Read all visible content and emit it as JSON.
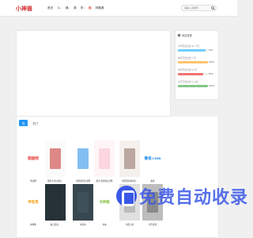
{
  "header": {
    "logo_text": "小神兽",
    "nav": [
      {
        "label": "首页",
        "has_dropdown": false
      },
      {
        "label": "人",
        "has_dropdown": true
      },
      {
        "label": "铺",
        "has_dropdown": true
      },
      {
        "label": "源",
        "has_dropdown": false
      },
      {
        "label": "学",
        "has_dropdown": true
      },
      {
        "label": "站",
        "has_dropdown": false,
        "hot": true
      },
      {
        "label": "林题源",
        "has_dropdown": false
      }
    ],
    "search_placeholder": "请输入关键字..."
  },
  "panel": {
    "title": "网站进程",
    "stats": [
      {
        "label": "今年已经过去 11 个月",
        "pct": 92,
        "pct_text": "92%",
        "color": "#4fc3f7"
      },
      {
        "label": "本月已经过去 7 天",
        "pct": 100,
        "pct_text": "100%",
        "color": "#ffb74d"
      },
      {
        "label": "本周已经过去 22 天",
        "pct": 85,
        "pct_text": "85%",
        "color": "#ef5350"
      },
      {
        "label": "今天已经过去 9 小时",
        "pct": 100,
        "pct_text": "100%",
        "color": "#66bb6a"
      }
    ]
  },
  "tabs": [
    {
      "label": "热",
      "active": true
    },
    {
      "label": "热门",
      "active": false
    }
  ],
  "cards_row1": [
    {
      "label": "国法网",
      "thumb_text": "图旋网",
      "thumb_color": "#e53935",
      "bg": "#ffffff"
    },
    {
      "label": "国家企业信用信...",
      "thumb_text": "",
      "thumb_color": "#c62828",
      "bg": "#fafafa"
    },
    {
      "label": "中国裁判文书网",
      "thumb_text": "",
      "thumb_color": "#1e88e5",
      "bg": "#ffffff"
    },
    {
      "label": "重庆市健康信息网",
      "thumb_text": "",
      "thumb_color": "#f8bbd0",
      "bg": "#fff5f7"
    },
    {
      "label": "中国国家图书馆...",
      "thumb_text": "",
      "thumb_color": "#8d6e63",
      "bg": "#f5f0ee"
    },
    {
      "label": "看看",
      "thumb_text": "看视.com",
      "thumb_color": "#1e88e5",
      "bg": "#ffffff"
    }
  ],
  "cards_row2": [
    {
      "label": "神笔笔",
      "thumb_text": "神笔馬",
      "thumb_color": "#f9a825",
      "bg": "#ffffff"
    },
    {
      "label": "看日语自...",
      "thumb_text": "",
      "thumb_color": "#263238",
      "bg": "#263238"
    },
    {
      "label": "尚阅书",
      "thumb_text": "",
      "thumb_color": "#455a64",
      "bg": "#37474f"
    },
    {
      "label": "书本",
      "thumb_text": "书神殿",
      "thumb_color": "#8bc34a",
      "bg": "#ffffff"
    },
    {
      "label": "免费小说",
      "thumb_text": "",
      "thumb_color": "#9e9e9e",
      "bg": "#e0e0e0"
    },
    {
      "label": "也予感冒",
      "thumb_text": "",
      "thumb_color": "#616161",
      "bg": "#bdbdbd"
    }
  ],
  "watermark": "免费自动收录"
}
